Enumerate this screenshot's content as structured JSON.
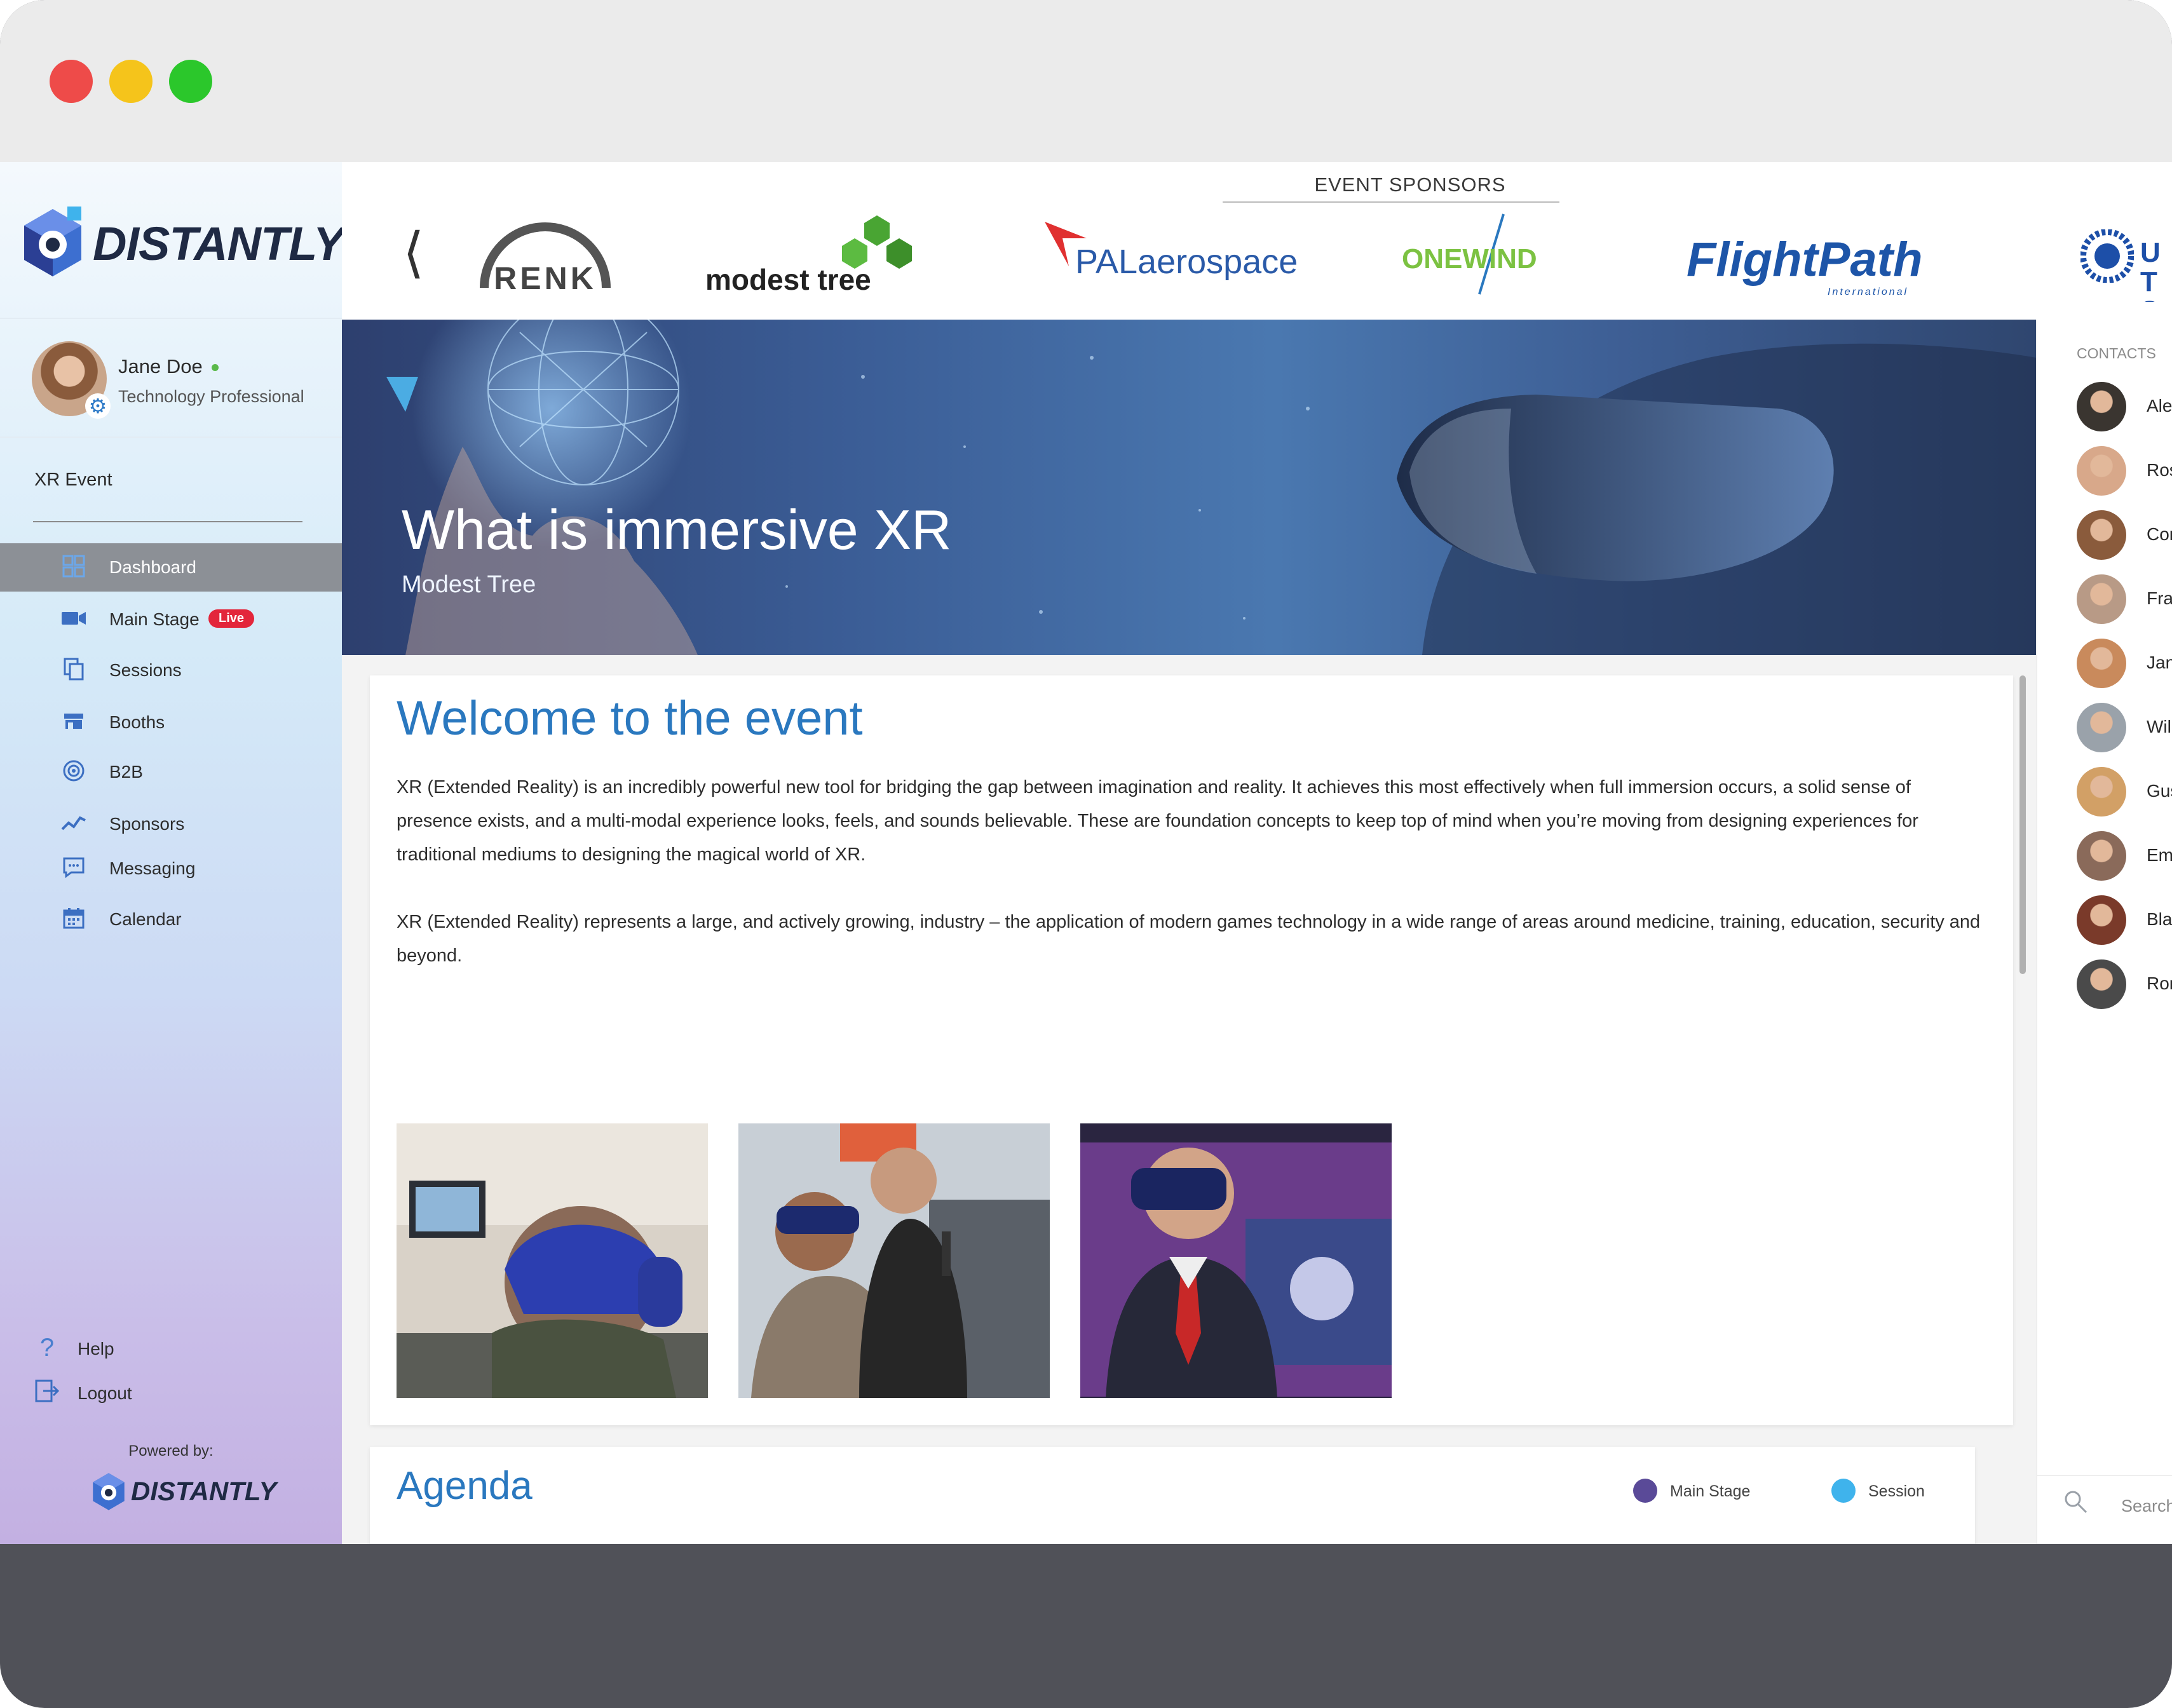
{
  "brand": {
    "name": "DISTANTLY"
  },
  "user": {
    "name": "Jane Doe",
    "role": "Technology Professional"
  },
  "event": {
    "name": "XR Event"
  },
  "nav": [
    {
      "label": "Dashboard",
      "icon": "dashboard-icon"
    },
    {
      "label": "Main Stage",
      "icon": "video-camera-icon",
      "badge": "Live"
    },
    {
      "label": "Sessions",
      "icon": "sessions-icon"
    },
    {
      "label": "Booths",
      "icon": "booth-store-icon"
    },
    {
      "label": "B2B",
      "icon": "b2b-target-icon"
    },
    {
      "label": "Sponsors",
      "icon": "trend-line-icon"
    },
    {
      "label": "Messaging",
      "icon": "chat-icon"
    },
    {
      "label": "Calendar",
      "icon": "calendar-icon"
    }
  ],
  "footer_nav": {
    "help": "Help",
    "logout": "Logout"
  },
  "powered": {
    "label": "Powered by:",
    "brand": "DISTANTLY"
  },
  "sponsors": {
    "title": "EVENT SPONSORS",
    "logos": [
      {
        "name": "RENK"
      },
      {
        "name": "modest tree"
      },
      {
        "name": "PALaerospace"
      },
      {
        "name": "ONEWIND"
      },
      {
        "name": "FlightPath",
        "tag": "International"
      },
      {
        "name": "UT Sy"
      }
    ]
  },
  "hero": {
    "title": "What is immersive XR",
    "subtitle": "Modest Tree"
  },
  "welcome": {
    "title": "Welcome to the event",
    "p1": "XR (Extended Reality) is an incredibly powerful new tool for bridging the gap between imagination and reality. It achieves this most effectively when full immersion occurs, a solid sense of presence exists, and a multi-modal experience looks, feels, and sounds believable. These are foundation concepts to keep top of mind when you’re moving from designing experiences for traditional mediums to designing the magical world of XR.",
    "p2": "XR (Extended Reality) represents a large, and actively growing, industry – the application of modern games technology in a wide range of areas around medicine, training, education, security and beyond."
  },
  "agenda": {
    "title": "Agenda",
    "legend": [
      {
        "label": "Main Stage",
        "color": "#5a4a98"
      },
      {
        "label": "Session",
        "color": "#3fb3ec"
      }
    ]
  },
  "contacts": {
    "title": "CONTACTS",
    "people": [
      {
        "name": "Ale"
      },
      {
        "name": "Ros"
      },
      {
        "name": "Cor"
      },
      {
        "name": "Fra"
      },
      {
        "name": "Jan"
      },
      {
        "name": "Wil"
      },
      {
        "name": "Gus"
      },
      {
        "name": "Emi"
      },
      {
        "name": "Bla"
      },
      {
        "name": "Ror"
      }
    ],
    "search_label": "Search"
  },
  "colors": {
    "accent": "#2a78bf",
    "live": "#e3263b",
    "nav_active": "#8c9096"
  }
}
